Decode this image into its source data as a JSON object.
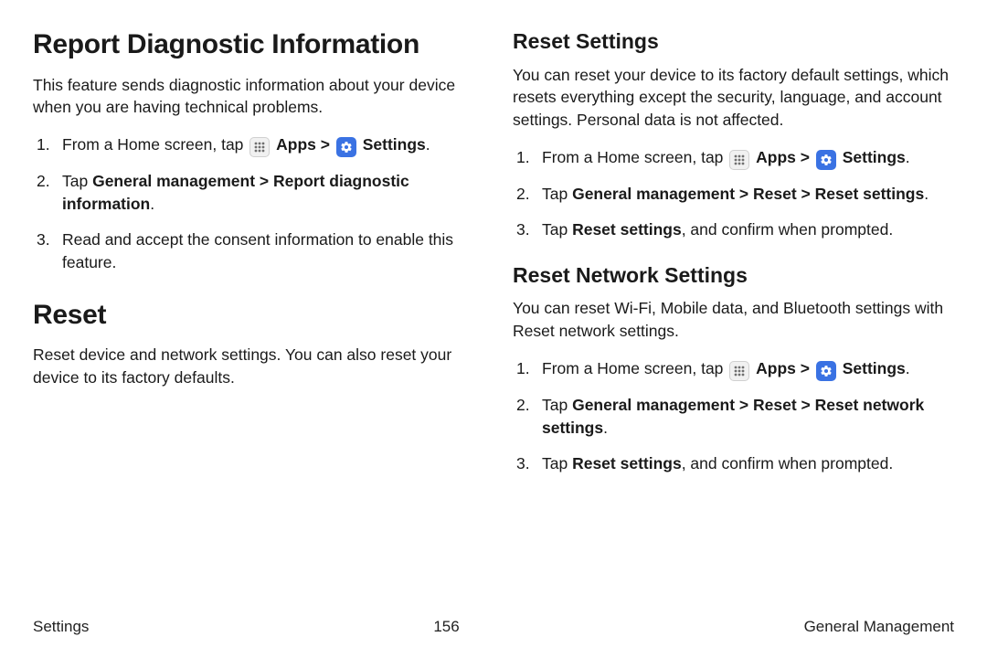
{
  "left": {
    "h1": "Report Diagnostic Information",
    "intro": "This feature sends diagnostic information about your device when you are having technical problems.",
    "steps": {
      "s1_pre": "From a Home screen, tap ",
      "apps_label": "Apps",
      "sep": " > ",
      "settings_label": "Settings",
      "period": ".",
      "s2_pre": "Tap ",
      "s2_bold": "General management > Report diagnostic information",
      "s3": "Read and accept the consent information to enable this feature."
    },
    "h1b": "Reset",
    "intro2": "Reset device and network settings. You can also reset your device to its factory defaults."
  },
  "right": {
    "h2a": "Reset Settings",
    "introA": "You can reset your device to its factory default settings, which resets everything except the security, language, and account settings. Personal data is not affected.",
    "stepsA": {
      "s1_pre": "From a Home screen, tap ",
      "apps_label": "Apps",
      "sep": " > ",
      "settings_label": "Settings",
      "period": ".",
      "s2_pre": "Tap ",
      "s2_bold": "General management > Reset > Reset settings",
      "s3_pre": "Tap ",
      "s3_bold": "Reset settings",
      "s3_post": ", and confirm when prompted."
    },
    "h2b": "Reset Network Settings",
    "introB": "You can reset Wi-Fi, Mobile data, and Bluetooth settings with Reset network settings.",
    "stepsB": {
      "s1_pre": "From a Home screen, tap ",
      "apps_label": "Apps",
      "sep": " > ",
      "settings_label": "Settings",
      "period": ".",
      "s2_pre": "Tap ",
      "s2_bold": "General management > Reset > Reset network settings",
      "s3_pre": "Tap ",
      "s3_bold": "Reset settings",
      "s3_post": ", and confirm when prompted."
    }
  },
  "footer": {
    "left": "Settings",
    "center": "156",
    "right": "General Management"
  }
}
